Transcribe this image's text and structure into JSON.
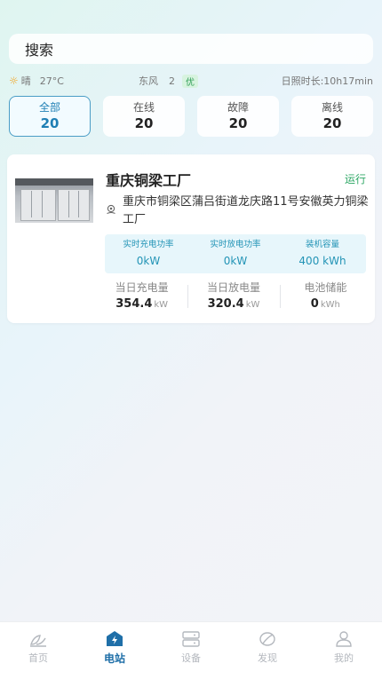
{
  "search": {
    "label": "搜索"
  },
  "weather": {
    "condition": "晴",
    "temperature": "27°C",
    "wind": "东风",
    "wind_level": "2",
    "air_quality": "优",
    "sunshine": "日照时长:10h17min"
  },
  "filter_tabs": [
    {
      "label": "全部",
      "count": "20",
      "active": true
    },
    {
      "label": "在线",
      "count": "20",
      "active": false
    },
    {
      "label": "故障",
      "count": "20",
      "active": false
    },
    {
      "label": "离线",
      "count": "20",
      "active": false
    }
  ],
  "station": {
    "name": "重庆铜梁工厂",
    "status": "运行",
    "address": "重庆市铜梁区蒲吕街道龙庆路11号安徽英力铜梁工厂",
    "metrics": [
      {
        "label": "实时充电功率",
        "value": "0kW"
      },
      {
        "label": "实时放电功率",
        "value": "0kW"
      },
      {
        "label": "装机容量",
        "value": "400 kWh"
      }
    ],
    "stats": [
      {
        "label": "当日充电量",
        "value": "354.4",
        "unit": "kW"
      },
      {
        "label": "当日放电量",
        "value": "320.4",
        "unit": "kW"
      },
      {
        "label": "电池储能",
        "value": "0",
        "unit": "kWh"
      }
    ]
  },
  "nav": [
    {
      "label": "首页",
      "icon": "home-leaf-icon",
      "active": false
    },
    {
      "label": "电站",
      "icon": "power-station-icon",
      "active": true
    },
    {
      "label": "设备",
      "icon": "device-server-icon",
      "active": false
    },
    {
      "label": "发现",
      "icon": "discover-leaf-icon",
      "active": false
    },
    {
      "label": "我的",
      "icon": "user-profile-icon",
      "active": false
    }
  ],
  "colors": {
    "accent": "#1e7fb4",
    "status_running": "#2fa866",
    "metric_text": "#2394b6",
    "metric_bg": "#e7f6fb"
  }
}
